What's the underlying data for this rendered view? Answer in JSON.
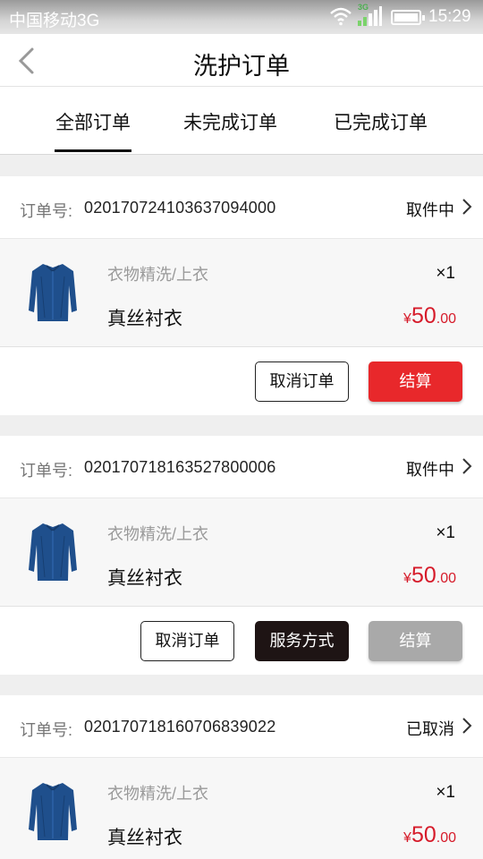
{
  "status_bar": {
    "carrier": "中国移动3G",
    "network": "3G",
    "time": "15:29"
  },
  "header": {
    "title": "洗护订单"
  },
  "tabs": [
    {
      "label": "全部订单",
      "active": true
    },
    {
      "label": "未完成订单",
      "active": false
    },
    {
      "label": "已完成订单",
      "active": false
    }
  ],
  "order_no_label": "订单号:",
  "orders": [
    {
      "order_no": "020170724103637094000",
      "status": "取件中",
      "item": {
        "category": "衣物精洗/上衣",
        "name": "真丝衬衣",
        "qty": "×1",
        "currency": "¥",
        "price_int": "50",
        "price_dec": ".00",
        "image": "blue-silk-shirt"
      },
      "buttons": {
        "cancel": "取消订单",
        "checkout": "结算"
      }
    },
    {
      "order_no": "020170718163527800006",
      "status": "取件中",
      "item": {
        "category": "衣物精洗/上衣",
        "name": "真丝衬衣",
        "qty": "×1",
        "currency": "¥",
        "price_int": "50",
        "price_dec": ".00",
        "image": "blue-silk-shirt"
      },
      "buttons": {
        "cancel": "取消订单",
        "service": "服务方式",
        "checkout": "结算"
      }
    },
    {
      "order_no": "020170718160706839022",
      "status": "已取消",
      "item": {
        "category": "衣物精洗/上衣",
        "name": "真丝衬衣",
        "qty": "×1",
        "currency": "¥",
        "price_int": "50",
        "price_dec": ".00",
        "image": "blue-silk-shirt"
      }
    }
  ],
  "colors": {
    "accent_red": "#e8282b",
    "price_red": "#d61b2a",
    "dark_button": "#1e1414",
    "disabled_button": "#a9a9a9"
  }
}
